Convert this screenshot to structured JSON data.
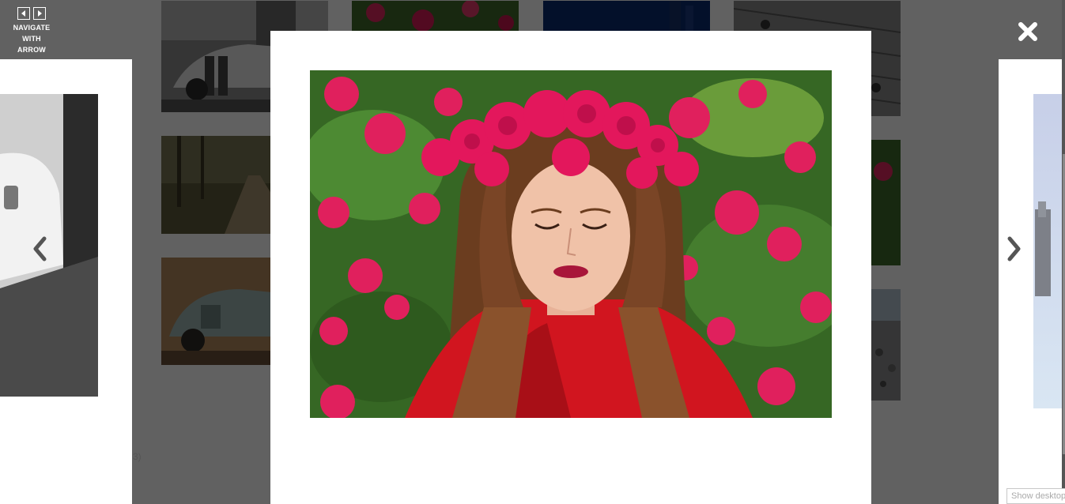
{
  "lightbox": {
    "nav_hint": "NAVIGATE WITH ARROW KEYS",
    "close_icon": "close-icon",
    "prev_icon": "chevron-left-icon",
    "next_icon": "chevron-right-icon"
  },
  "background_page": {
    "count_suffix": "3)",
    "show_desktop_label": "Show desktop"
  },
  "colors": {
    "overlay": "#000000",
    "card": "#ffffff"
  }
}
